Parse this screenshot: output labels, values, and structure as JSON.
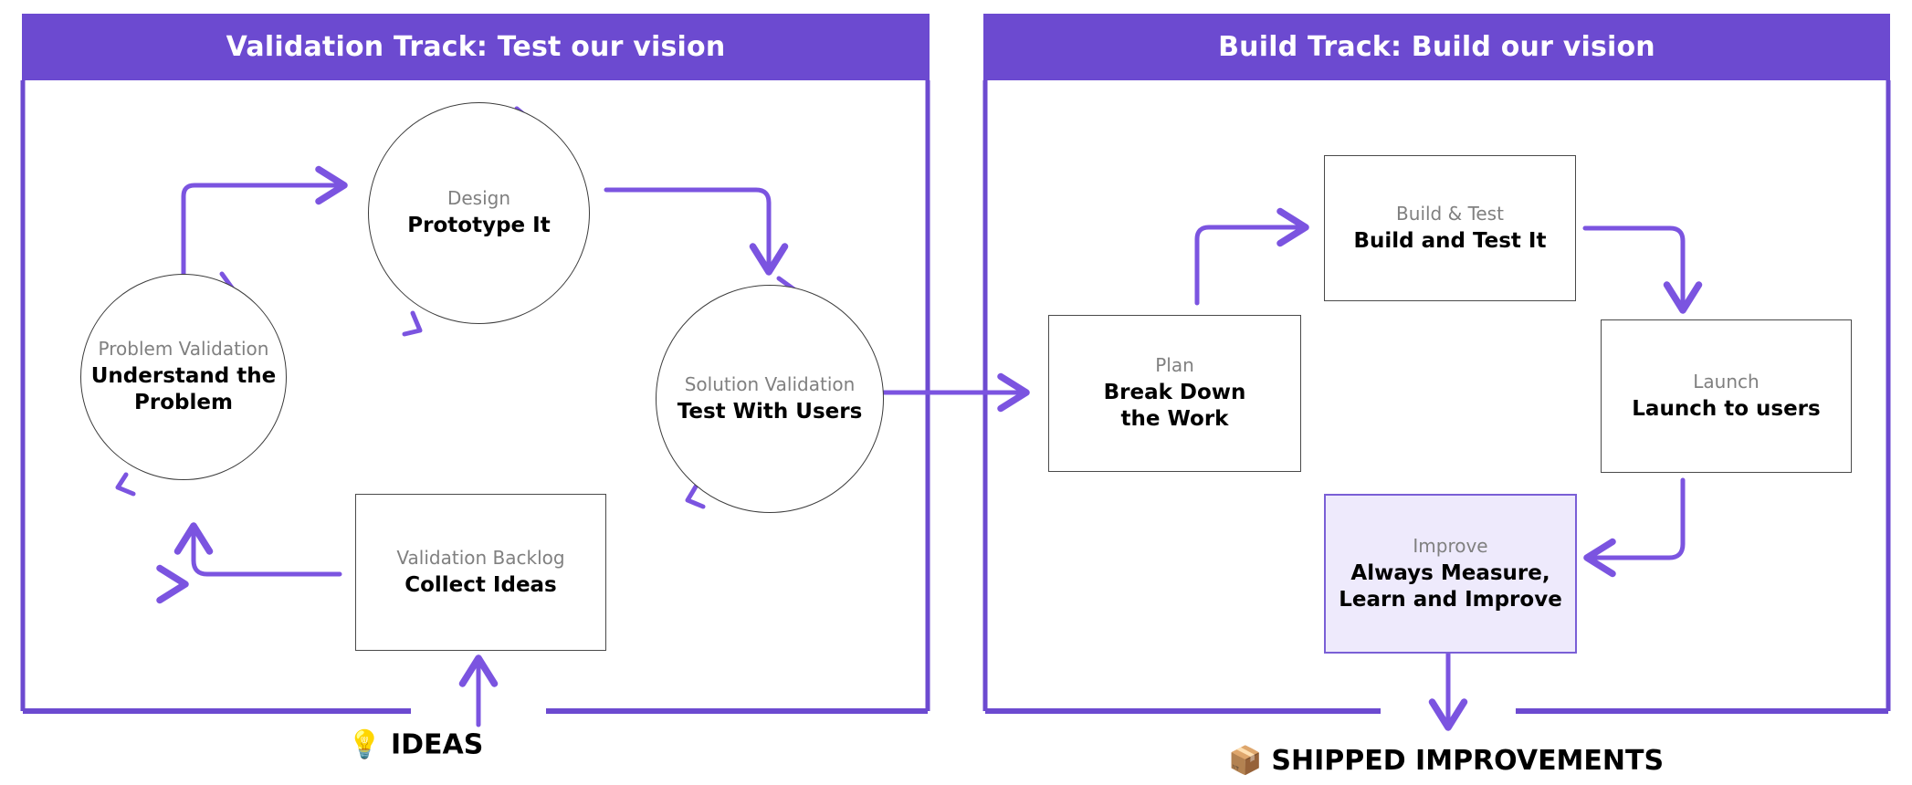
{
  "theme": {
    "accent_purple": "#6C4AD0",
    "arrow_purple": "#7B54E0",
    "node_border": "#4a4a4a",
    "circle_border": "#3c3c3c",
    "sub_text": "#808080",
    "main_text": "#000000",
    "improve_fill": "#eeeafc",
    "improve_border": "#7a5fd6",
    "header_text": "#ffffff",
    "page_bg": "#ffffff"
  },
  "tracks": [
    {
      "id": "validation",
      "title": "Validation Track: Test our vision",
      "nodes": [
        {
          "id": "problem-validation",
          "shape": "circle",
          "sub": "Problem Validation",
          "main": "Understand the\nProblem"
        },
        {
          "id": "design",
          "shape": "circle",
          "sub": "Design",
          "main": "Prototype It"
        },
        {
          "id": "solution-validation",
          "shape": "circle",
          "sub": "Solution Validation",
          "main": "Test With Users"
        },
        {
          "id": "validation-backlog",
          "shape": "box",
          "sub": "Validation Backlog",
          "main": "Collect Ideas"
        }
      ],
      "outcome": {
        "icon": "lightbulb-icon",
        "emoji": "💡",
        "label": "IDEAS"
      }
    },
    {
      "id": "build",
      "title": "Build Track: Build our vision",
      "nodes": [
        {
          "id": "plan",
          "shape": "box",
          "sub": "Plan",
          "main": "Break Down\nthe Work"
        },
        {
          "id": "build-test",
          "shape": "box",
          "sub": "Build & Test",
          "main": "Build and Test It"
        },
        {
          "id": "launch",
          "shape": "box",
          "sub": "Launch",
          "main": "Launch to users"
        },
        {
          "id": "improve",
          "shape": "box-accent",
          "sub": "Improve",
          "main": "Always Measure,\nLearn and Improve"
        }
      ],
      "outcome": {
        "icon": "package-icon",
        "emoji": "📦",
        "label": "SHIPPED IMPROVEMENTS"
      }
    }
  ],
  "connections": [
    {
      "id": "backlog-to-problem",
      "from": "validation-backlog",
      "to": "problem-validation"
    },
    {
      "id": "problem-to-design",
      "from": "problem-validation",
      "to": "design"
    },
    {
      "id": "design-to-solution",
      "from": "design",
      "to": "solution-validation"
    },
    {
      "id": "validation-to-build",
      "from": "solution-validation",
      "to": "plan"
    },
    {
      "id": "plan-to-build-test",
      "from": "plan",
      "to": "build-test"
    },
    {
      "id": "build-test-to-launch",
      "from": "build-test",
      "to": "launch"
    },
    {
      "id": "launch-to-improve",
      "from": "launch",
      "to": "improve"
    },
    {
      "id": "ideas-into-validation",
      "from": "ideas",
      "to": "validation-backlog"
    },
    {
      "id": "improve-to-shipped",
      "from": "improve",
      "to": "shipped-improvements"
    }
  ]
}
